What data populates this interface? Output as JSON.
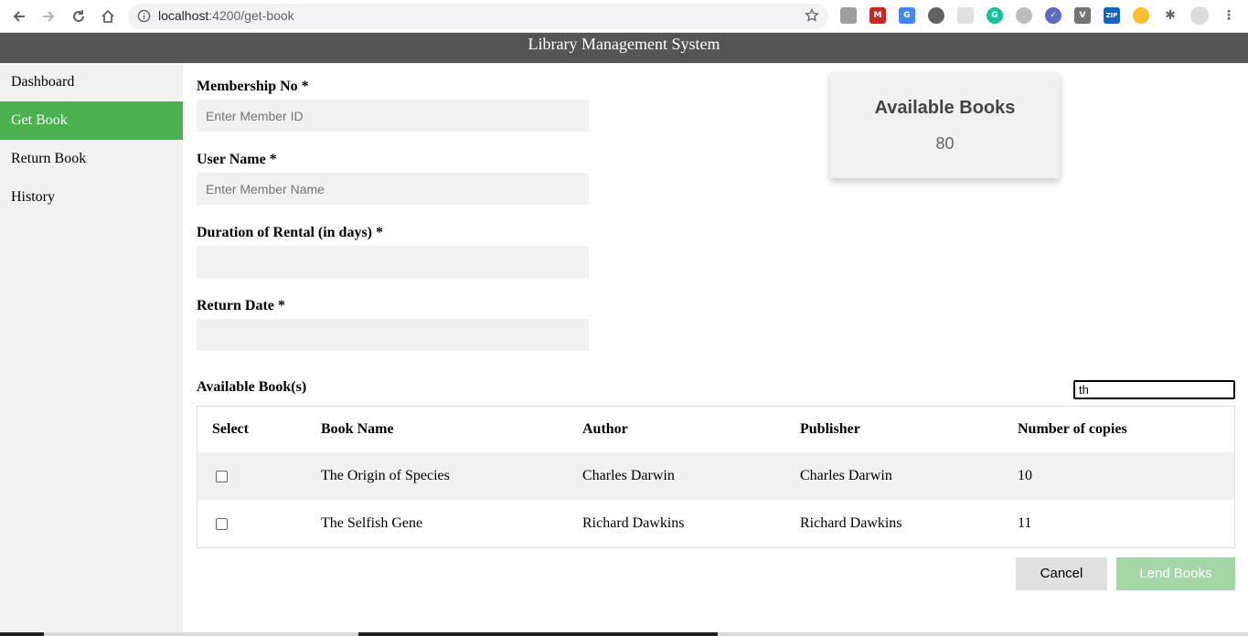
{
  "browser": {
    "url_host": "localhost",
    "url_rest": ":4200/get-book"
  },
  "app": {
    "title": "Library Management System"
  },
  "sidebar": {
    "items": [
      {
        "label": "Dashboard"
      },
      {
        "label": "Get Book"
      },
      {
        "label": "Return Book"
      },
      {
        "label": "History"
      }
    ],
    "active_index": 1
  },
  "form": {
    "membership_label": "Membership No *",
    "membership_placeholder": "Enter Member ID",
    "username_label": "User Name *",
    "username_placeholder": "Enter Member Name",
    "duration_label": "Duration of Rental (in days) *",
    "return_label": "Return Date *"
  },
  "card": {
    "title": "Available Books",
    "count": "80"
  },
  "books_section": {
    "title": "Available Book(s)",
    "search_value": "th"
  },
  "table": {
    "headers": [
      "Select",
      "Book Name",
      "Author",
      "Publisher",
      "Number of copies"
    ],
    "rows": [
      {
        "book": "The Origin of Species",
        "author": "Charles Darwin",
        "publisher": "Charles Darwin",
        "copies": "10"
      },
      {
        "book": "The Selfish Gene",
        "author": "Richard Dawkins",
        "publisher": "Richard Dawkins",
        "copies": "11"
      }
    ]
  },
  "buttons": {
    "cancel": "Cancel",
    "lend": "Lend Books"
  },
  "colors": {
    "header_bg": "#555555",
    "active_nav": "#4caf50",
    "lend_button": "#a5d6a7"
  }
}
